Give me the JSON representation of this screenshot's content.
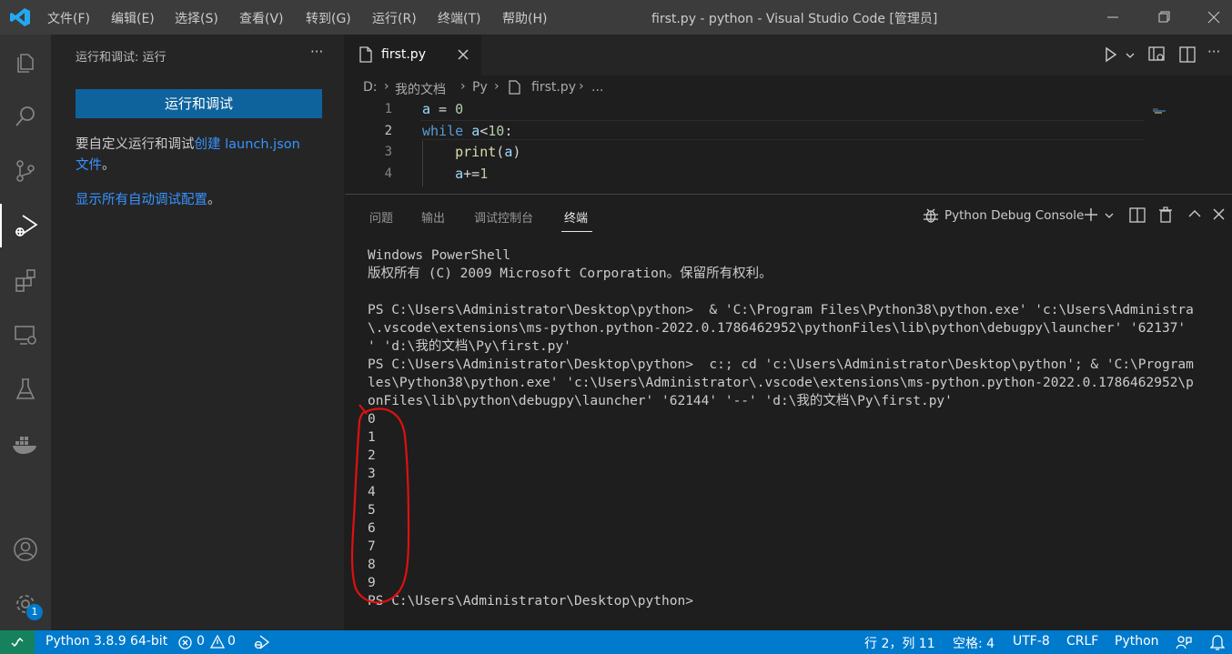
{
  "titlebar": {
    "menu": [
      "文件(F)",
      "编辑(E)",
      "选择(S)",
      "查看(V)",
      "转到(G)",
      "运行(R)",
      "终端(T)",
      "帮助(H)"
    ],
    "title": "first.py - python - Visual Studio Code [管理员]"
  },
  "activity": {
    "icons": [
      "explorer-icon",
      "search-icon",
      "source-control-icon",
      "run-debug-icon",
      "extensions-icon",
      "remote-explorer-icon",
      "testing-icon",
      "docker-icon",
      "account-icon",
      "manage-gear-icon"
    ],
    "manage_badge": "1"
  },
  "sidebar": {
    "header": "运行和调试: 运行",
    "more": "···",
    "run_button": "运行和调试",
    "text_prefix": "要自定义运行和调试",
    "link_create": "创建 launch.json",
    "link_file": "文件",
    "text_suffix": "。",
    "link_show": "显示所有自动调试配置",
    "text_end": "。"
  },
  "editor": {
    "tab_label": "first.py",
    "breadcrumb": [
      "D:",
      "我的文档",
      "Py",
      "first.py",
      "..."
    ],
    "lines": [
      {
        "n": "1",
        "code": "a = 0"
      },
      {
        "n": "2",
        "code": "while a<10:"
      },
      {
        "n": "3",
        "code": "    print(a)"
      },
      {
        "n": "4",
        "code": "    a+=1"
      }
    ]
  },
  "panel": {
    "tabs": [
      "问题",
      "输出",
      "调试控制台",
      "终端"
    ],
    "active_tab": "终端",
    "terminal_name": "Python Debug Console",
    "terminal_lines": [
      "Windows PowerShell",
      "版权所有 (C) 2009 Microsoft Corporation。保留所有权利。",
      "",
      "PS C:\\Users\\Administrator\\Desktop\\python>  & 'C:\\Program Files\\Python38\\python.exe' 'c:\\Users\\Administra",
      "\\.vscode\\extensions\\ms-python.python-2022.0.1786462952\\pythonFiles\\lib\\python\\debugpy\\launcher' '62137'",
      "' 'd:\\我的文档\\Py\\first.py'",
      "PS C:\\Users\\Administrator\\Desktop\\python>  c:; cd 'c:\\Users\\Administrator\\Desktop\\python'; & 'C:\\Program",
      "les\\Python38\\python.exe' 'c:\\Users\\Administrator\\.vscode\\extensions\\ms-python.python-2022.0.1786462952\\p",
      "onFiles\\lib\\python\\debugpy\\launcher' '62144' '--' 'd:\\我的文档\\Py\\first.py'",
      "0",
      "1",
      "2",
      "3",
      "4",
      "5",
      "6",
      "7",
      "8",
      "9",
      "PS C:\\Users\\Administrator\\Desktop\\python>"
    ]
  },
  "statusbar": {
    "interpreter": "Python 3.8.9 64-bit",
    "errors": "0",
    "warnings": "0",
    "position": "行 2，列 11",
    "indent": "空格: 4",
    "encoding": "UTF-8",
    "eol": "CRLF",
    "language": "Python"
  },
  "colors": {
    "accent": "#007acc",
    "run_button": "#0e639c",
    "link": "#3794ff",
    "annotation": "#e01010"
  }
}
